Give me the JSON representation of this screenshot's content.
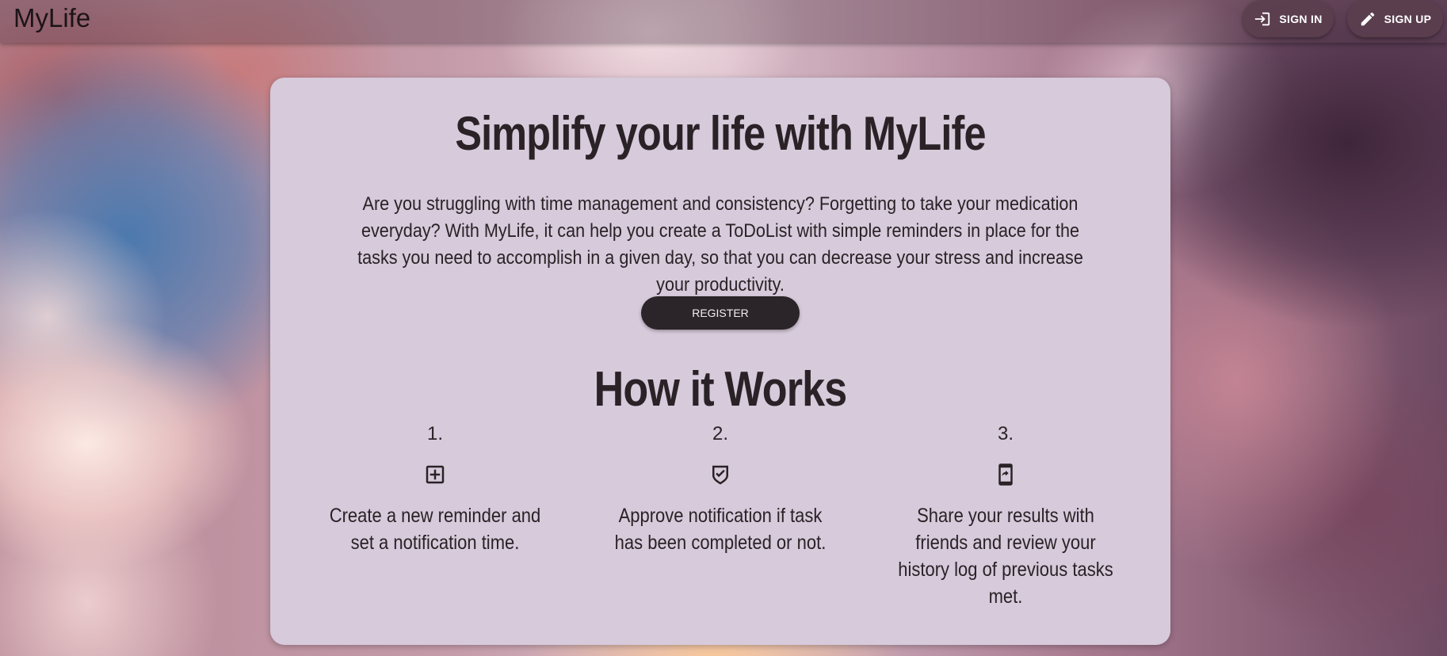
{
  "header": {
    "brand": "MyLife",
    "signin_label": "SIGN IN",
    "signup_label": "SIGN UP",
    "signin_icon": "login-icon",
    "signup_icon": "pencil-icon"
  },
  "hero": {
    "title": "Simplify your life with MyLife",
    "intro": "Are you struggling with time management and consistency? Forgetting to take your medication everyday? With MyLife, it can help you create a ToDoList with simple reminders in place for the tasks you need to accomplish in a given day, so that you can decrease your stress and increase your productivity.",
    "register_label": "REGISTER"
  },
  "how": {
    "title": "How it Works",
    "steps": [
      {
        "number": "1.",
        "icon": "add-box-icon",
        "text": "Create a new reminder and set a notification time."
      },
      {
        "number": "2.",
        "icon": "verified-shield-icon",
        "text": "Approve notification if task has been completed or not."
      },
      {
        "number": "3.",
        "icon": "share-phone-icon",
        "text": "Share your results with friends and review your history log of previous tasks met."
      }
    ]
  },
  "colors": {
    "card_background": "#d6cadb",
    "text_dark": "#2a2226",
    "register_button": "#2b2428",
    "nav_button": "#5a3e4e"
  }
}
